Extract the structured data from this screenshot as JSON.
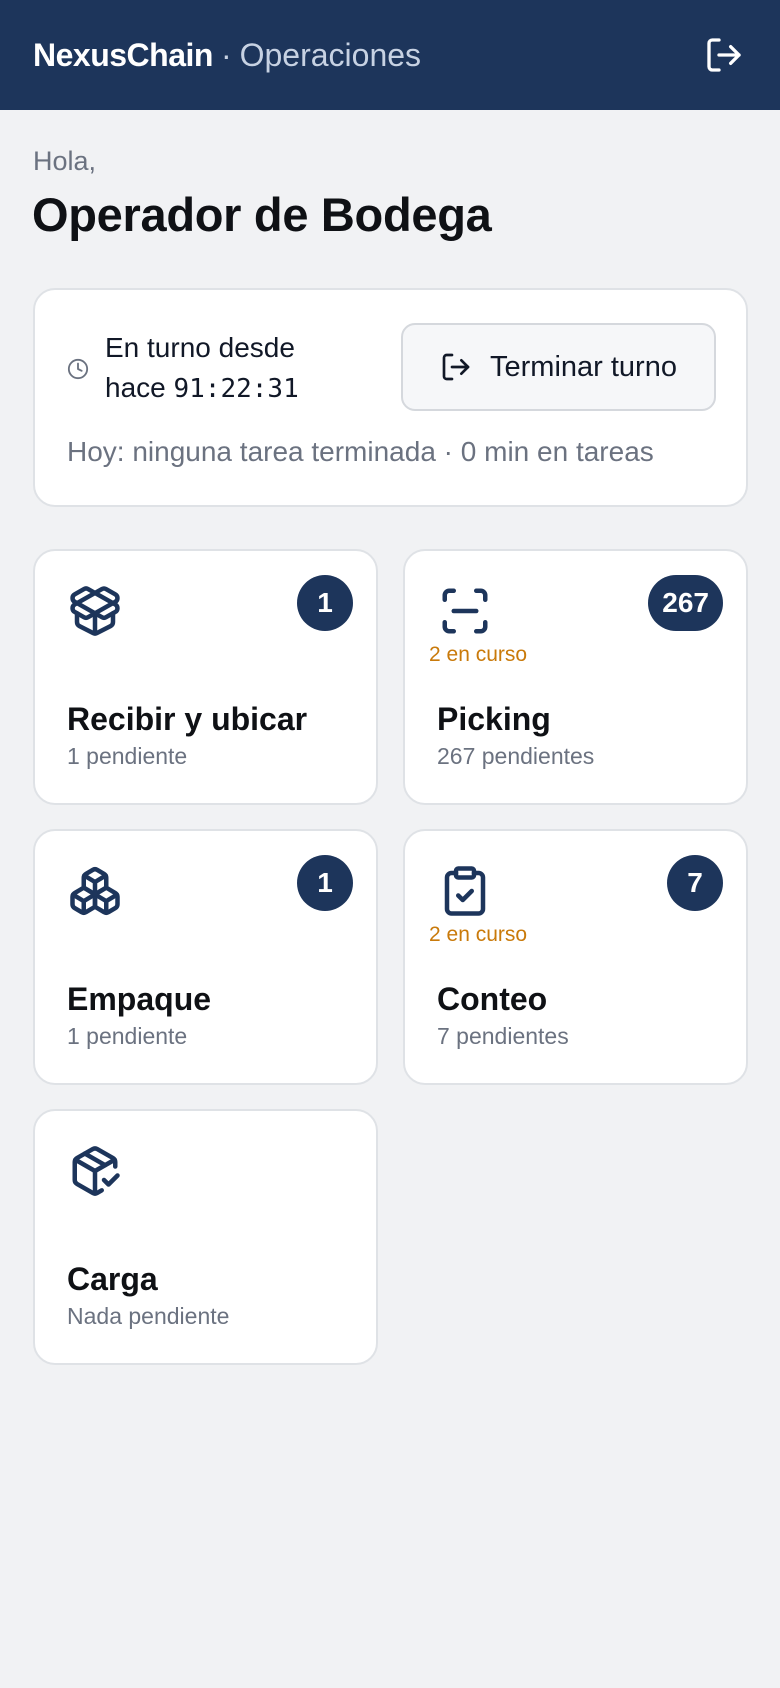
{
  "header": {
    "brand": "NexusChain",
    "separator": "·",
    "section": "Operaciones",
    "logout_icon": "logout-icon"
  },
  "greeting": {
    "hello": "Hola,",
    "name": "Operador de Bodega"
  },
  "shift": {
    "line1": "En turno desde",
    "since_prefix": "hace",
    "timer": "91:22:31",
    "end_button": "Terminar turno",
    "stats": "Hoy: ninguna tarea terminada · 0 min en tareas",
    "clock_icon": "clock-icon",
    "end_icon": "logout-icon"
  },
  "tasks": [
    {
      "id": "recibir",
      "title": "Recibir y ubicar",
      "subtitle": "1 pendiente",
      "badge": "1",
      "in_progress": "",
      "icon": "package-open-icon"
    },
    {
      "id": "picking",
      "title": "Picking",
      "subtitle": "267 pendientes",
      "badge": "267",
      "in_progress": "2 en curso",
      "icon": "scan-icon"
    },
    {
      "id": "empaque",
      "title": "Empaque",
      "subtitle": "1 pendiente",
      "badge": "1",
      "in_progress": "",
      "icon": "boxes-icon"
    },
    {
      "id": "conteo",
      "title": "Conteo",
      "subtitle": "7 pendientes",
      "badge": "7",
      "in_progress": "2 en curso",
      "icon": "clipboard-check-icon"
    },
    {
      "id": "carga",
      "title": "Carga",
      "subtitle": "Nada pendiente",
      "badge": "",
      "in_progress": "",
      "icon": "package-check-icon"
    }
  ],
  "colors": {
    "header_bg": "#1d355b",
    "badge_bg": "#1d355b",
    "in_progress": "#c97a0b",
    "page_bg": "#f1f2f4"
  }
}
